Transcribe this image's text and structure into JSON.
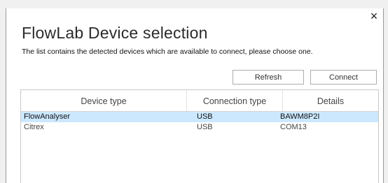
{
  "dialog": {
    "close_label": "×",
    "title": "FlowLab Device selection",
    "subtitle": "The list contains the detected devices which are available to connect, please choose one."
  },
  "buttons": {
    "refresh": "Refresh",
    "connect": "Connect"
  },
  "table": {
    "columns": [
      "Device type",
      "Connection type",
      "Details"
    ],
    "rows": [
      {
        "device_type": "FlowAnalyser",
        "connection_type": "USB",
        "details": "BAWM8P2I",
        "selected": true
      },
      {
        "device_type": "Citrex",
        "connection_type": "USB",
        "details": "COM13",
        "selected": false
      }
    ]
  },
  "colors": {
    "selected_row": "#cce8ff"
  }
}
